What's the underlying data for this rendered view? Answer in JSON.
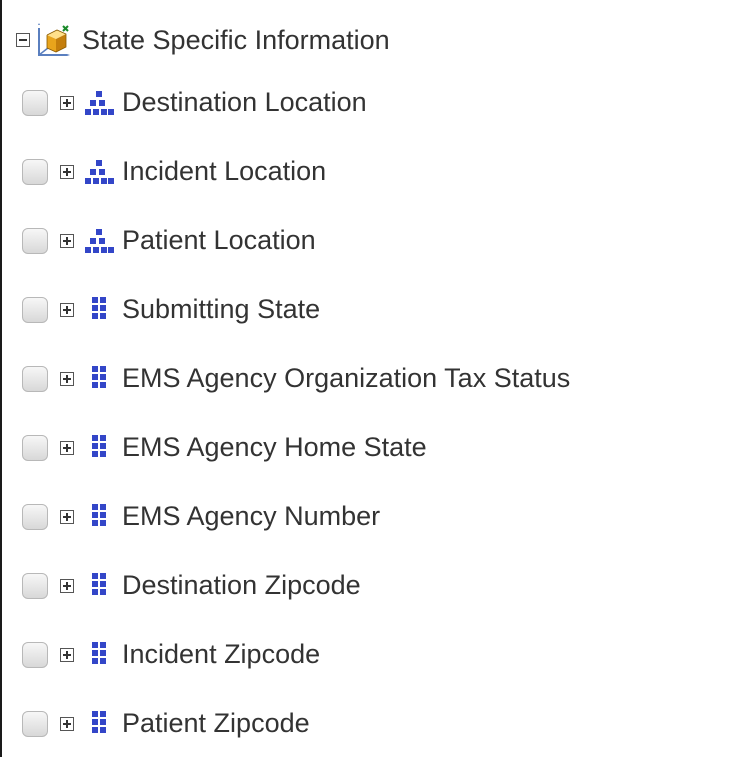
{
  "tree": {
    "root": {
      "label": "State Specific Information",
      "icon": "cube-icon"
    },
    "children": [
      {
        "label": "Destination Location",
        "icon": "hierarchy-icon",
        "checked": false
      },
      {
        "label": "Incident Location",
        "icon": "hierarchy-icon",
        "checked": false
      },
      {
        "label": "Patient Location",
        "icon": "hierarchy-icon",
        "checked": false
      },
      {
        "label": "Submitting State",
        "icon": "dimension-grid-icon",
        "checked": false
      },
      {
        "label": "EMS Agency Organization Tax Status",
        "icon": "dimension-grid-icon",
        "checked": false
      },
      {
        "label": "EMS Agency Home State",
        "icon": "dimension-grid-icon",
        "checked": false
      },
      {
        "label": "EMS Agency Number",
        "icon": "dimension-grid-icon",
        "checked": false
      },
      {
        "label": "Destination Zipcode",
        "icon": "dimension-grid-icon",
        "checked": false
      },
      {
        "label": "Incident Zipcode",
        "icon": "dimension-grid-icon",
        "checked": false
      },
      {
        "label": "Patient Zipcode",
        "icon": "dimension-grid-icon",
        "checked": false
      }
    ]
  },
  "colors": {
    "text": "#333333",
    "icon_blue": "#3346c8",
    "cube_gold": "#e5a31a",
    "border": "#1a1a1a"
  }
}
